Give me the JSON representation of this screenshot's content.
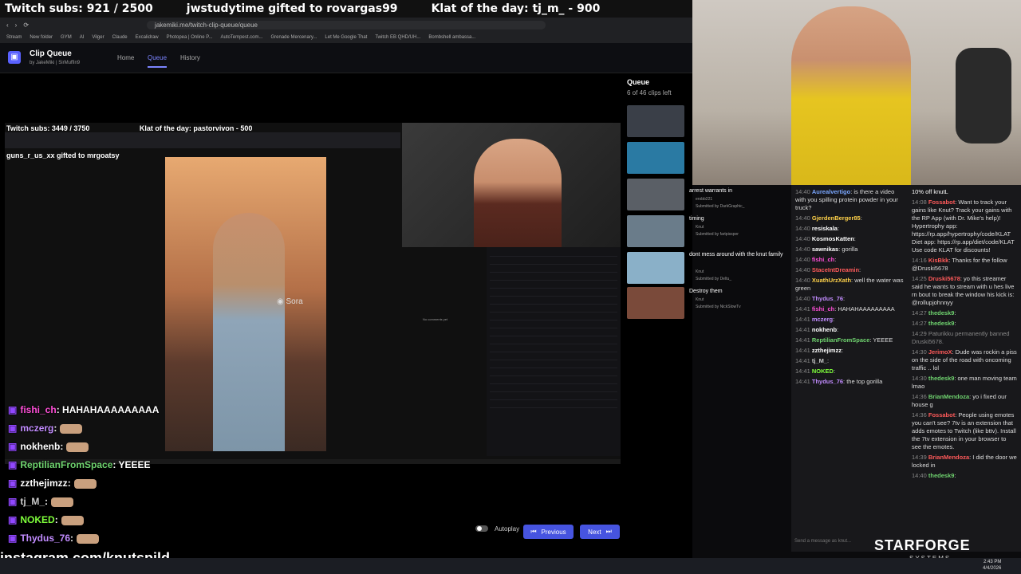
{
  "overlay": {
    "subs": "Twitch subs: 921 / 2500",
    "gift": "jwstudytime gifted to rovargas99",
    "klat": "Klat of the day: tj_m_ - 900"
  },
  "browser": {
    "url": "jakemiki.me/twitch-clip-queue/queue",
    "bookmarks": [
      "Stream",
      "New folder",
      "GYM",
      "AI",
      "Vilger",
      "Claude",
      "Excalidraw",
      "Photopea | Online P...",
      "AutoTempest.com...",
      "Grenade Mercenary...",
      "Let Me Google That",
      "Twitch EB QHD/UH...",
      "Bombshell ambassa..."
    ]
  },
  "app": {
    "title": "Clip Queue",
    "subtitle": "by JakeMiki | SirMuffin9",
    "nav": {
      "home": "Home",
      "queue": "Queue",
      "history": "History"
    }
  },
  "video": {
    "overlay_subs": "Twitch subs: 3449 / 3750",
    "overlay_klat": "Klat of the day: pastorvivon - 500",
    "gift": "guns_r_us_xx gifted to mrgoatsy",
    "watermark": "Sora",
    "no_comments": "No comments yet"
  },
  "stream_chat": [
    {
      "user": "fishi_ch",
      "msg": ": HAHAHAAAAAAAAA",
      "color": "#ff4fd8"
    },
    {
      "user": "mczerg",
      "msg": ":",
      "color": "#c28cff"
    },
    {
      "user": "nokhenb",
      "msg": ":",
      "color": "#ffffff"
    },
    {
      "user": "ReptilianFromSpace",
      "msg": ": YEEEE",
      "color": "#6fd36f"
    },
    {
      "user": "zzthejimzz",
      "msg": ":",
      "color": "#ffffff"
    },
    {
      "user": "tj_M_",
      "msg": ":",
      "color": "#cccccc"
    },
    {
      "user": "NOKED",
      "msg": ":",
      "color": "#7fff3b"
    },
    {
      "user": "Thydus_76",
      "msg": ":",
      "color": "#c28cff"
    }
  ],
  "insta": "instagram.com/knutspild",
  "queue": {
    "title": "Queue",
    "count": "6 of 46 clips left",
    "clips": [
      {
        "title": "arrest warrants in",
        "sub1": "erobb221",
        "sub2": "Submitted by DarkGraphic_",
        "color": "#3a3f48"
      },
      {
        "title": "timing",
        "sub1": "Knut",
        "sub2": "Submitted by fartpissper",
        "color": "#2a7aa3"
      },
      {
        "title": "dont mess around with the knut family",
        "sub1": "Knut",
        "sub2": "Submitted by Deltu_",
        "color": "#6a7c8a"
      },
      {
        "title": "Destroy them",
        "sub1": "Knut",
        "sub2": "Submitted by NickSlowTv",
        "color": "#7a4a3a"
      }
    ]
  },
  "controls": {
    "autoplay": "Autoplay",
    "previous": "Previous",
    "next": "Next"
  },
  "chat_left": [
    {
      "time": "14:40",
      "user": "Aurealvertigo",
      "msg": ": is there a video with you spilling protein powder in your truck?",
      "color": "#7aa7ff"
    },
    {
      "time": "14:40",
      "user": "GjerdenBerger85",
      "msg": ":",
      "color": "#ffd24a"
    },
    {
      "time": "14:40",
      "user": "resiskala",
      "msg": ":",
      "color": "#ffffff"
    },
    {
      "time": "14:40",
      "user": "KosmosKatten",
      "msg": ":",
      "color": "#ffffff"
    },
    {
      "time": "14:40",
      "user": "sawnikas",
      "msg": ": gorilla",
      "color": "#ffffff"
    },
    {
      "time": "14:40",
      "user": "fishi_ch",
      "msg": ":",
      "color": "#ff4fd8"
    },
    {
      "time": "14:40",
      "user": "StaceIntDreamin",
      "msg": ":",
      "color": "#ff5a5a"
    },
    {
      "time": "14:40",
      "user": "XuathUrzXath",
      "msg": ": well the water was green",
      "color": "#ffd24a"
    },
    {
      "time": "14:40",
      "user": "Thydus_76",
      "msg": ":",
      "color": "#c28cff"
    },
    {
      "time": "14:41",
      "user": "fishi_ch",
      "msg": ": HAHAHAAAAAAAAA",
      "color": "#ff4fd8"
    },
    {
      "time": "14:41",
      "user": "mczerg",
      "msg": ":",
      "color": "#c28cff"
    },
    {
      "time": "14:41",
      "user": "nokhenb",
      "msg": ":",
      "color": "#ffffff"
    },
    {
      "time": "14:41",
      "user": "ReptilianFromSpace",
      "msg": ": YEEEE",
      "color": "#6fd36f"
    },
    {
      "time": "14:41",
      "user": "zzthejimzz",
      "msg": ":",
      "color": "#ffffff"
    },
    {
      "time": "14:41",
      "user": "tj_M_",
      "msg": ":",
      "color": "#cccccc"
    },
    {
      "time": "14:41",
      "user": "NOKED",
      "msg": ":",
      "color": "#7fff3b"
    },
    {
      "time": "14:41",
      "user": "Thydus_76",
      "msg": ": the top gorilla",
      "color": "#c28cff"
    }
  ],
  "chat_right": [
    {
      "time": "",
      "user": "",
      "msg": "10% off knutL",
      "color": "#ffffff"
    },
    {
      "time": "14:08",
      "user": "Fossabot",
      "msg": ": Want to track your gains like Knut? Track your gains with the RP App (with Dr. Mike's help)! Hypertrophy app: https://rp.app/hypertrophy/code/KLAT Diet app: https://rp.app/diet/code/KLAT Use code KLAT for discounts!",
      "color": "#ff5a5a"
    },
    {
      "time": "14:16",
      "user": "KisBkk",
      "msg": ": Thanks for the follow @Druski5678",
      "color": "#ff5a5a"
    },
    {
      "time": "14:25",
      "user": "Druski5678",
      "msg": ": yo this streamer said he wants to stream with u hes live rn bout to break the window his kick is: @rollupjohnnyy",
      "color": "#ff5a5a"
    },
    {
      "time": "14:27",
      "user": "thedesk9",
      "msg": ":",
      "color": "#6fd36f"
    },
    {
      "time": "14:27",
      "user": "thedesk9",
      "msg": ":",
      "color": "#6fd36f"
    },
    {
      "time": "14:29",
      "user": "",
      "msg": "Paturikku permanently banned Druski5678.",
      "color": "#888888"
    },
    {
      "time": "14:30",
      "user": "JerimoX",
      "msg": ": Dude was rockin a piss on the side of the road with oncoming traffic .. lol",
      "color": "#ff5a5a"
    },
    {
      "time": "14:30",
      "user": "thedesk9",
      "msg": ": one man moving team lmao",
      "color": "#6fd36f"
    },
    {
      "time": "14:36",
      "user": "BrianMendoza",
      "msg": ": yo i fixed our house g",
      "color": "#6fd36f"
    },
    {
      "time": "14:36",
      "user": "Fossabot",
      "msg": ": People using emotes you can't see? 7tv is an extension that adds emotes to Twitch (like bttv). Install the 7tv extension in your browser to see the emotes.",
      "color": "#ff5a5a"
    },
    {
      "time": "14:39",
      "user": "BrianMendoza",
      "msg": ": I did the door we locked in",
      "color": "#ff5a5a"
    },
    {
      "time": "14:40",
      "user": "thedesk9",
      "msg": ":",
      "color": "#6fd36f"
    }
  ],
  "chat_input_placeholder": "Send a message as knut...",
  "brand": {
    "name": "STARFORGE",
    "sub": "SYSTEMS"
  },
  "clock": {
    "time": "2:43 PM",
    "date": "4/4/2026"
  }
}
